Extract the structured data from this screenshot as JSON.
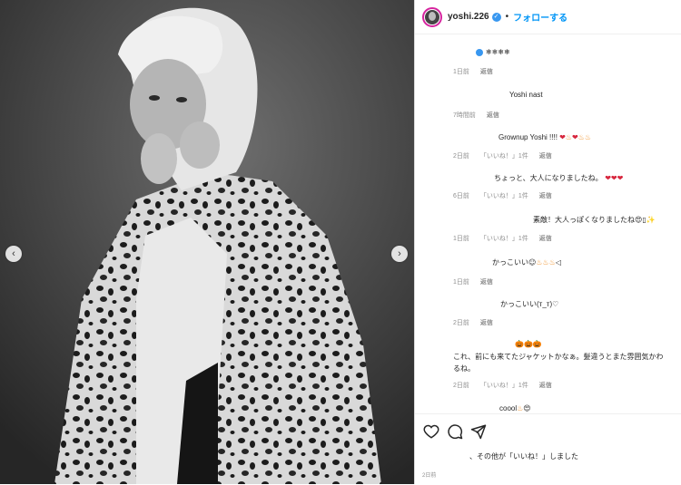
{
  "header": {
    "username": "yoshi.226",
    "separator": "•",
    "follow_label": "フォローする"
  },
  "colors": {
    "follow": "#0095f6",
    "verified": "#3897f0",
    "meta": "#8e8e8e",
    "avatar_ring": "#d6249f"
  },
  "comments": [
    {
      "text": "❄❄❄❄",
      "time": "1日前",
      "reply": "返信"
    },
    {
      "text": "Yoshi nast",
      "time": "7時間前",
      "reply": "返信"
    },
    {
      "text": "Grownup Yoshi !!!! ",
      "time": "2日前",
      "likes": "「いいね！」1件",
      "reply": "返信"
    },
    {
      "text": "ちょっと、大人になりましたね。",
      "time": "6日前",
      "likes": "「いいね！」1件",
      "reply": "返信"
    },
    {
      "text": "素敵！大人っぽくなりましたね",
      "time": "1日前",
      "likes": "「いいね！」1件",
      "reply": "返信"
    },
    {
      "text": "かっこいい",
      "time": "1日前",
      "reply": "返信"
    },
    {
      "text": "かっこいい(т_т)♡",
      "time": "2日前",
      "reply": "返信"
    },
    {
      "text": "これ、前にも来てたジャケットかなぁ。髪違うとまた雰囲気かわるね。",
      "time": "2日前",
      "likes": "「いいね！」1件",
      "reply": "返信"
    },
    {
      "text": "coool"
    }
  ],
  "likes_text": "、その他が「いいね！」しました",
  "post_date": "2日前"
}
